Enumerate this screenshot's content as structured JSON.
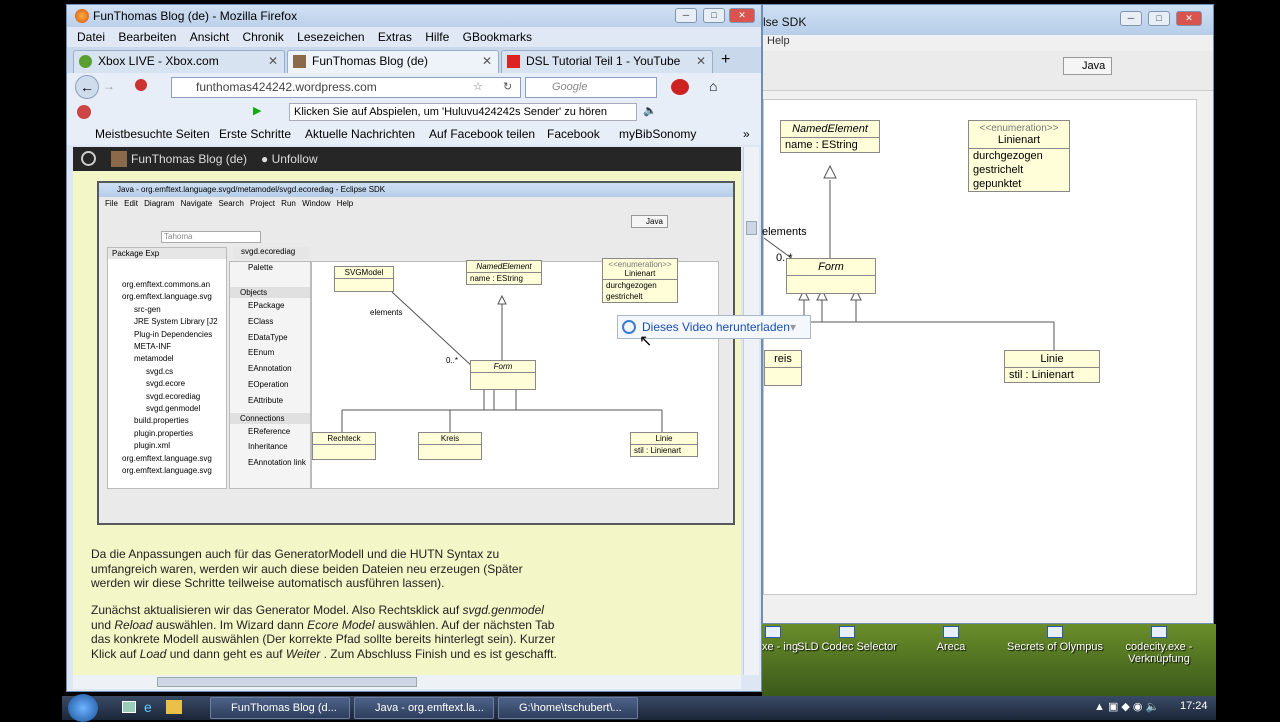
{
  "firefox": {
    "title": "FunThomas Blog (de) - Mozilla Firefox",
    "menu": [
      "Datei",
      "Bearbeiten",
      "Ansicht",
      "Chronik",
      "Lesezeichen",
      "Extras",
      "Hilfe",
      "GBookmarks"
    ],
    "tabs": [
      {
        "label": "Xbox LIVE - Xbox.com",
        "icon": "xbox-icon"
      },
      {
        "label": "FunThomas Blog (de)",
        "icon": "blog-icon",
        "active": true
      },
      {
        "label": "DSL Tutorial Teil 1 - YouTube",
        "icon": "youtube-icon"
      }
    ],
    "url": "funthomas424242.wordpress.com",
    "search_placeholder": "Google",
    "ticker": "Klicken Sie auf Abspielen, um 'Huluvu424242s Sender' zu hören",
    "bookmarks": [
      "Meistbesuchte Seiten",
      "Erste Schritte",
      "Aktuelle Nachrichten",
      "Auf Facebook teilen",
      "Facebook",
      "myBibSonomy"
    ],
    "wp_bar": {
      "blog": "FunThomas Blog (de)",
      "unfollow": "Unfollow"
    }
  },
  "screenshot": {
    "title": "Java - org.emftext.language.svgd/metamodel/svgd.ecorediag - Eclipse SDK",
    "menu": [
      "File",
      "Edit",
      "Diagram",
      "Navigate",
      "Search",
      "Project",
      "Run",
      "Window",
      "Help"
    ],
    "font": "Tahoma",
    "perspective": "Java",
    "package_tab": "Package Exp",
    "editor_tab": "svgd.ecorediag",
    "tree": [
      "org.emftext.commons.an",
      "org.emftext.language.svg",
      "src-gen",
      "JRE System Library [J2",
      "Plug-in Dependencies",
      "META-INF",
      "metamodel",
      "svgd.cs",
      "svgd.ecore",
      "svgd.ecorediag",
      "svgd.genmodel",
      "build.properties",
      "plugin.properties",
      "plugin.xml",
      "org.emftext.language.svg",
      "org.emftext.language.svg"
    ],
    "palette": {
      "title": "Palette",
      "objects": "Objects",
      "object_items": [
        "EPackage",
        "EClass",
        "EDataType",
        "EEnum",
        "EAnnotation",
        "EOperation",
        "EAttribute"
      ],
      "connections": "Connections",
      "connection_items": [
        "EReference",
        "Inheritance",
        "EAnnotation link"
      ]
    },
    "diagram": {
      "svgmodel": "SVGModel",
      "named_element": "NamedElement",
      "name_attr": "name : EString",
      "enum_label": "<<enumeration>>",
      "linienart": "Linienart",
      "enum_values": [
        "durchgezogen",
        "gestrichelt"
      ],
      "elements": "elements",
      "mult": "0..*",
      "form": "Form",
      "rechteck": "Rechteck",
      "kreis": "Kreis",
      "linie": "Linie",
      "stil": "stil : Linienart"
    }
  },
  "download_popup": "Dieses Video herunterladen",
  "article": {
    "p1": "Da die Anpassungen auch für das GeneratorModell und die HUTN Syntax zu umfangreich waren, werden wir auch diese beiden Dateien neu erzeugen (Später werden wir diese Schritte teilweise automatisch ausführen lassen).",
    "p2_a": "Zunächst aktualisieren wir das Generator Model. Also Rechtsklick auf ",
    "p2_b": "svgd.genmodel",
    "p2_c": " und ",
    "p2_d": "Reload",
    "p2_e": " auswählen. Im Wizard dann ",
    "p2_f": "Ecore Model",
    "p2_g": " auswählen. Auf der nächsten Tab das konkrete Modell auswählen (Der korrekte Pfad sollte bereits hinterlegt sein). Kurzer Klick auf ",
    "p2_h": "Load",
    "p2_i": " und dann geht es auf ",
    "p2_j": "Weiter",
    "p2_k": " . Zum Abschluss Finish und es ist geschafft."
  },
  "bg_eclipse": {
    "title": "lse SDK",
    "help": "Help",
    "perspective": "Java",
    "named_element": "NamedElement",
    "name_attr": "name : EString",
    "enum_label": "<<enumeration>>",
    "linienart": "Linienart",
    "enum_values": [
      "durchgezogen",
      "gestrichelt",
      "gepunktet"
    ],
    "elements": "elements",
    "mult": "0..*",
    "form": "Form",
    "kreis": "reis",
    "linie": "Linie",
    "stil": "stil : Linienart"
  },
  "desktop_icons": [
    {
      "label": "ll.exe - ing",
      "icon": "shortcut-icon"
    },
    {
      "label": "SLD Codec Selector",
      "icon": "shortcut-icon"
    },
    {
      "label": "Areca",
      "icon": "shortcut-icon"
    },
    {
      "label": "Secrets of Olympus",
      "icon": "shortcut-icon"
    },
    {
      "label": "codecity.exe - Verknüpfung",
      "icon": "shortcut-icon"
    }
  ],
  "taskbar": {
    "items": [
      "FunThomas Blog (d...",
      "Java - org.emftext.la...",
      "G:\\home\\tschubert\\..."
    ],
    "time": "17:24"
  }
}
